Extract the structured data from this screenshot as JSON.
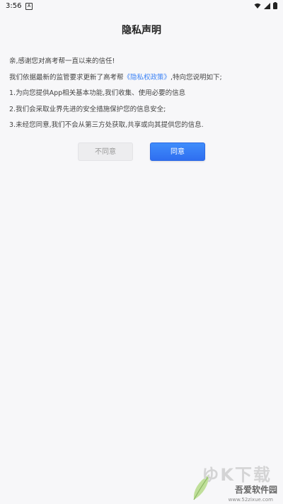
{
  "status_bar": {
    "time": "3:56",
    "icons": [
      "app-notification-icon",
      "wifi-icon",
      "signal-icon",
      "battery-icon"
    ]
  },
  "dialog": {
    "title": "隐私声明",
    "greeting": "亲,感谢您对高考帮一直以来的信任!",
    "line2_before": "我们依据最新的监管要求更新了高考帮",
    "policy_link": "《隐私权政策》",
    "line2_after": ",特向您说明如下;",
    "item1": "1.为向您提供App相关基本功能,我们收集、使用必要的信息",
    "item2": "2.我们会采取业界先进的安全措施保护您的信息安全;",
    "item3": "3.未经您同意,我们不会从第三方处获取,共享或向其提供您的信息.",
    "disagree_label": "不同意",
    "agree_label": "同意"
  },
  "colors": {
    "accent": "#3b82f6",
    "button_primary": "#2f6ef0",
    "background": "#f7f7f9"
  },
  "watermark": {
    "big_text": "ゆK下载",
    "name": "吾爱软件园",
    "url": "www.52zixue.com"
  }
}
